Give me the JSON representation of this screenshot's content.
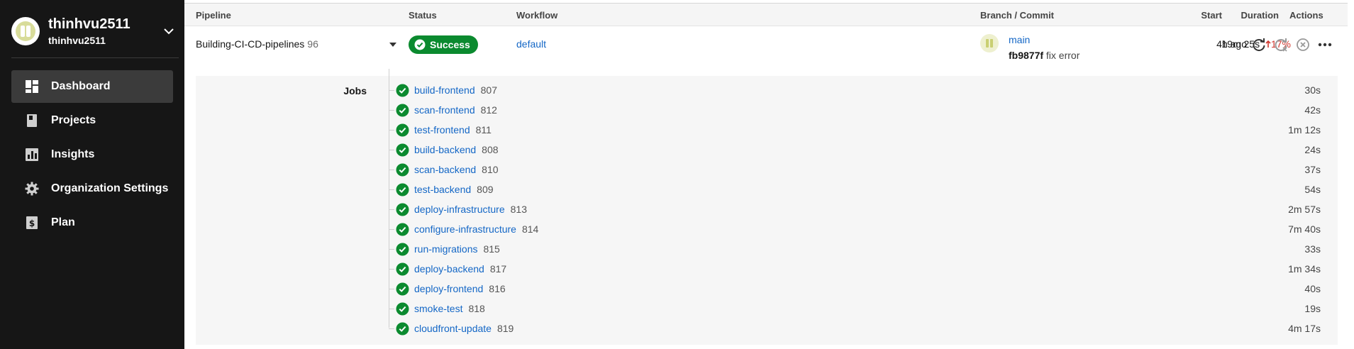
{
  "sidebar": {
    "org_name": "thinhvu2511",
    "org_sub": "thinhvu2511",
    "items": [
      {
        "label": "Dashboard",
        "icon": "dashboard-icon",
        "active": true
      },
      {
        "label": "Projects",
        "icon": "projects-icon"
      },
      {
        "label": "Insights",
        "icon": "insights-icon"
      },
      {
        "label": "Organization Settings",
        "icon": "gear-icon"
      },
      {
        "label": "Plan",
        "icon": "dollar-icon"
      }
    ]
  },
  "table": {
    "headers": {
      "pipeline": "Pipeline",
      "status": "Status",
      "workflow": "Workflow",
      "branch_commit": "Branch / Commit",
      "start": "Start",
      "duration": "Duration",
      "actions": "Actions"
    },
    "pipeline": {
      "name": "Building-CI-CD-pipelines",
      "number": "96",
      "status": "Success",
      "workflow": "default",
      "branch": "main",
      "commit_sha": "fb9877f",
      "commit_message": "fix error",
      "start": "4h ago",
      "duration": "19m 25s",
      "duration_change": "17%"
    }
  },
  "jobs_label": "Jobs",
  "jobs": [
    {
      "name": "build-frontend",
      "number": "807",
      "duration": "30s"
    },
    {
      "name": "scan-frontend",
      "number": "812",
      "duration": "42s"
    },
    {
      "name": "test-frontend",
      "number": "811",
      "duration": "1m 12s"
    },
    {
      "name": "build-backend",
      "number": "808",
      "duration": "24s"
    },
    {
      "name": "scan-backend",
      "number": "810",
      "duration": "37s"
    },
    {
      "name": "test-backend",
      "number": "809",
      "duration": "54s"
    },
    {
      "name": "deploy-infrastructure",
      "number": "813",
      "duration": "2m 57s"
    },
    {
      "name": "configure-infrastructure",
      "number": "814",
      "duration": "7m 40s"
    },
    {
      "name": "run-migrations",
      "number": "815",
      "duration": "33s"
    },
    {
      "name": "deploy-backend",
      "number": "817",
      "duration": "1m 34s"
    },
    {
      "name": "deploy-frontend",
      "number": "816",
      "duration": "40s"
    },
    {
      "name": "smoke-test",
      "number": "818",
      "duration": "19s"
    },
    {
      "name": "cloudfront-update",
      "number": "819",
      "duration": "4m 17s"
    }
  ],
  "colors": {
    "sidebar_bg": "#161616",
    "success": "#0b8a2f",
    "link": "#1467c6",
    "regression": "#d0372e"
  }
}
